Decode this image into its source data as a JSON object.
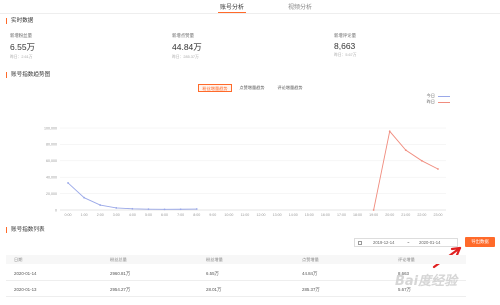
{
  "nav": {
    "tabs": [
      {
        "label": "账号分析",
        "active": true
      },
      {
        "label": "视频分析",
        "active": false
      }
    ]
  },
  "realtime": {
    "title": "实时数据",
    "stats": [
      {
        "label": "新增粉丝量",
        "value": "6.55万",
        "sub": "昨日：2.61万"
      },
      {
        "label": "新增点赞量",
        "value": "44.84万",
        "sub": "昨日：285.37万"
      },
      {
        "label": "新增评论量",
        "value": "8,663",
        "sub": "昨日：5.67万"
      }
    ]
  },
  "trend": {
    "title": "账号指数趋势图",
    "tabs": [
      "粉丝增量趋势",
      "点赞增量趋势",
      "评论增量趋势"
    ],
    "active_tab": 0,
    "legend": [
      "今日",
      "昨日"
    ]
  },
  "colors": {
    "accent": "#ff6a2a",
    "today": "#9aa8e8",
    "yesterday": "#f08c7e"
  },
  "chart_data": {
    "type": "line",
    "x": [
      "0:00",
      "1:00",
      "2:00",
      "3:00",
      "4:00",
      "5:00",
      "6:00",
      "7:00",
      "8:00",
      "9:00",
      "10:00",
      "11:00",
      "12:00",
      "13:00",
      "14:00",
      "15:00",
      "16:00",
      "17:00",
      "18:00",
      "19:00",
      "20:00",
      "21:00",
      "22:00",
      "23:00"
    ],
    "ylim": [
      0,
      100000
    ],
    "yticks": [
      "100,000",
      "80,000",
      "60,000",
      "40,000",
      "20,000",
      "0"
    ],
    "series": [
      {
        "name": "今日",
        "values": [
          33000,
          15000,
          6000,
          2500,
          1500,
          1000,
          800,
          900,
          1200,
          null,
          null,
          null,
          null,
          null,
          null,
          null,
          null,
          null,
          null,
          null,
          null,
          null,
          null,
          null
        ]
      },
      {
        "name": "昨日",
        "values": [
          null,
          null,
          null,
          null,
          null,
          null,
          null,
          null,
          null,
          null,
          null,
          null,
          null,
          null,
          null,
          null,
          null,
          null,
          null,
          0,
          96000,
          73000,
          60000,
          50000
        ]
      }
    ]
  },
  "list": {
    "title": "账号指数列表",
    "date_start": "2019-12-14",
    "date_sep": "~",
    "date_end": "2020-01-14",
    "export_label": "导出数据",
    "columns": [
      "日期",
      "粉丝总量",
      "粉丝增量",
      "点赞增量",
      "评论增量"
    ],
    "rows": [
      [
        "2020-01-14",
        "2960.81万",
        "6.55万",
        "44.84万",
        "8,663"
      ],
      [
        "2020-01-13",
        "2954.27万",
        "28.01万",
        "285.37万",
        "5.67万"
      ]
    ]
  },
  "watermark": "Bai度经验"
}
